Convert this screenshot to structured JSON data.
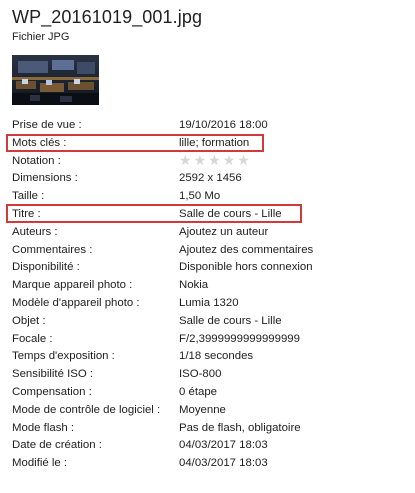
{
  "header": {
    "file_name": "WP_20161019_001.jpg",
    "file_type": "Fichier JPG"
  },
  "thumbnail": {
    "icon": "classroom-photo-thumbnail"
  },
  "properties": [
    {
      "label": "Prise de vue :",
      "value": "19/10/2016 18:00"
    },
    {
      "label": "Mots clés :",
      "value": "lille; formation"
    },
    {
      "label": "Notation :",
      "value": "",
      "rating": 0,
      "rating_max": 5
    },
    {
      "label": "Dimensions :",
      "value": "2592 x 1456"
    },
    {
      "label": "Taille :",
      "value": "1,50 Mo"
    },
    {
      "label": "Titre :",
      "value": "Salle de cours - Lille"
    },
    {
      "label": "Auteurs :",
      "value": "Ajoutez un auteur"
    },
    {
      "label": "Commentaires :",
      "value": "Ajoutez des commentaires"
    },
    {
      "label": "Disponibilité :",
      "value": "Disponible hors connexion"
    },
    {
      "label": "Marque appareil photo :",
      "value": "Nokia"
    },
    {
      "label": "Modèle d'appareil photo :",
      "value": "Lumia 1320"
    },
    {
      "label": "Objet :",
      "value": "Salle de cours - Lille"
    },
    {
      "label": "Focale :",
      "value": "F/2,3999999999999999"
    },
    {
      "label": "Temps d'exposition :",
      "value": "1/18 secondes"
    },
    {
      "label": "Sensibilité ISO :",
      "value": "ISO-800"
    },
    {
      "label": "Compensation :",
      "value": "0 étape"
    },
    {
      "label": "Mode de contrôle de logiciel :",
      "value": "Moyenne"
    },
    {
      "label": "Mode flash :",
      "value": "Pas de flash, obligatoire"
    },
    {
      "label": "Date de création :",
      "value": "04/03/2017 18:03"
    },
    {
      "label": "Modifié le :",
      "value": "04/03/2017 18:03"
    }
  ],
  "highlight_color": "#d23a3a"
}
